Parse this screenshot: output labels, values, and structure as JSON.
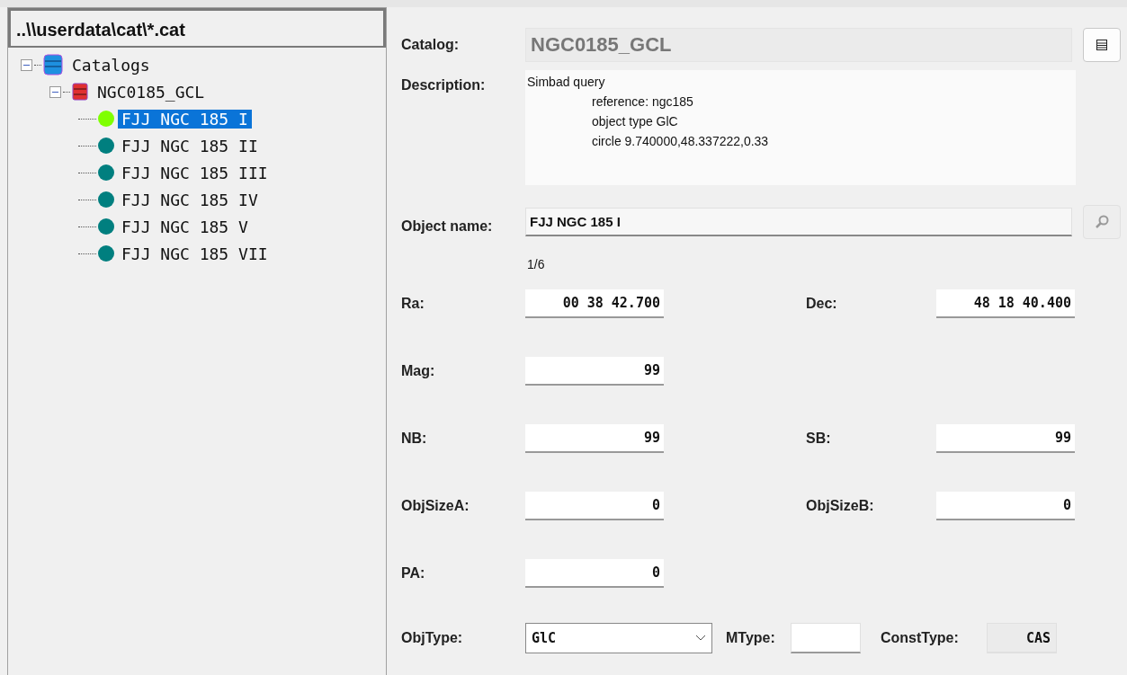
{
  "path_header": "..\\\\userdata\\cat\\*.cat",
  "tree": [
    {
      "label": "Catalogs",
      "kind": "database",
      "expanded": true,
      "children": [
        {
          "label": "NGC0185_GCL",
          "kind": "table",
          "expanded": true,
          "children": [
            {
              "label": "FJJ NGC 185 I",
              "kind": "object",
              "selected": true,
              "color": "#7fff00"
            },
            {
              "label": "FJJ NGC 185 II",
              "kind": "object",
              "selected": false,
              "color": "#007f7f"
            },
            {
              "label": "FJJ NGC 185 III",
              "kind": "object",
              "selected": false,
              "color": "#007f7f"
            },
            {
              "label": "FJJ NGC 185 IV",
              "kind": "object",
              "selected": false,
              "color": "#007f7f"
            },
            {
              "label": "FJJ NGC 185 V",
              "kind": "object",
              "selected": false,
              "color": "#007f7f"
            },
            {
              "label": "FJJ NGC 185 VII",
              "kind": "object",
              "selected": false,
              "color": "#007f7f"
            }
          ]
        }
      ]
    }
  ],
  "catalog": {
    "label": "Catalog:",
    "value": "NGC0185_GCL"
  },
  "description": {
    "label": "Description:",
    "lines": [
      {
        "text": "Simbad query",
        "indented": false
      },
      {
        "text": "reference: ngc185",
        "indented": true
      },
      {
        "text": "object type GlC",
        "indented": true
      },
      {
        "text": "circle 9.740000,48.337222,0.33",
        "indented": true
      }
    ]
  },
  "object_name": {
    "label": "Object name:",
    "value": "FJJ NGC 185 I"
  },
  "counter": "1/6",
  "rows": [
    {
      "left": {
        "label": "Ra:",
        "value": "00 38 42.700"
      },
      "right": {
        "label": "Dec:",
        "value": "48 18 40.400"
      }
    },
    {
      "left": {
        "label": "Mag:",
        "value": "99"
      }
    },
    {
      "left": {
        "label": "NB:",
        "value": "99"
      },
      "right": {
        "label": "SB:",
        "value": "99"
      }
    },
    {
      "left": {
        "label": "ObjSizeA:",
        "value": "0"
      },
      "right": {
        "label": "ObjSizeB:",
        "value": "0"
      }
    },
    {
      "left": {
        "label": "PA:",
        "value": "0"
      }
    }
  ],
  "obj_type": {
    "label": "ObjType:",
    "value": "GlC"
  },
  "m_type": {
    "label": "MType:"
  },
  "const_type": {
    "label": "ConstType:",
    "value": "CAS"
  }
}
